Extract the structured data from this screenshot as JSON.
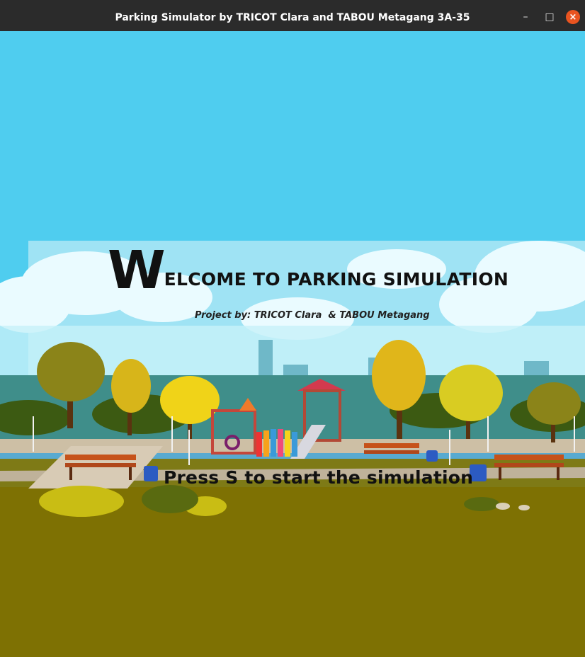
{
  "window": {
    "title": "Parking Simulator by TRICOT Clara and TABOU Metagang 3A-35",
    "minimize_glyph": "–",
    "maximize_glyph": "□",
    "close_glyph": "×"
  },
  "welcome": {
    "big_letter": "W",
    "rest": "ELCOME TO PARKING SIMULATION"
  },
  "subtitle": "Project by: TRICOT Clara  & TABOU Metagang",
  "prompt": "Press S to start the simulation",
  "colors": {
    "sky": "#4fcdef",
    "ground": "#7e7103",
    "titlebar": "#2b2b2b",
    "close_button": "#e95420"
  }
}
